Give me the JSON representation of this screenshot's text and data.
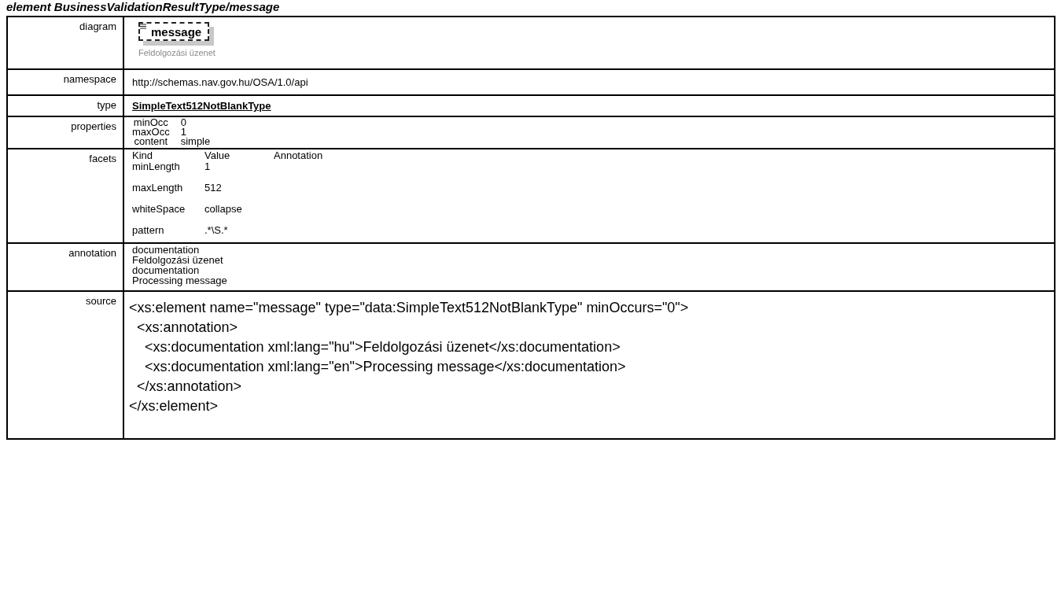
{
  "heading": "element BusinessValidationResultType/message",
  "diagram": {
    "label": "diagram",
    "element_name": "message",
    "caption": "Feldolgozási üzenet"
  },
  "namespace": {
    "label": "namespace",
    "value": "http://schemas.nav.gov.hu/OSA/1.0/api"
  },
  "type": {
    "label": "type",
    "value": "SimpleText512NotBlankType"
  },
  "properties": {
    "label": "properties",
    "rows": [
      {
        "name": "minOcc",
        "value": "0"
      },
      {
        "name": "maxOcc",
        "value": "1"
      },
      {
        "name": "content",
        "value": "simple"
      }
    ]
  },
  "facets": {
    "label": "facets",
    "columns": [
      "Kind",
      "Value",
      "Annotation"
    ],
    "rows": [
      {
        "kind": "minLength",
        "value": "1"
      },
      {
        "kind": "maxLength",
        "value": "512"
      },
      {
        "kind": "whiteSpace",
        "value": "collapse"
      },
      {
        "kind": "pattern",
        "value": ".*\\S.*"
      }
    ]
  },
  "annotation": {
    "label": "annotation",
    "lines": [
      "documentation",
      "Feldolgozási üzenet",
      "documentation",
      "Processing message"
    ]
  },
  "source": {
    "label": "source",
    "lines": [
      "<xs:element name=\"message\" type=\"data:SimpleText512NotBlankType\" minOccurs=\"0\">",
      "  <xs:annotation>",
      "    <xs:documentation xml:lang=\"hu\">Feldolgozási üzenet</xs:documentation>",
      "    <xs:documentation xml:lang=\"en\">Processing message</xs:documentation>",
      "  </xs:annotation>",
      "</xs:element>"
    ]
  }
}
